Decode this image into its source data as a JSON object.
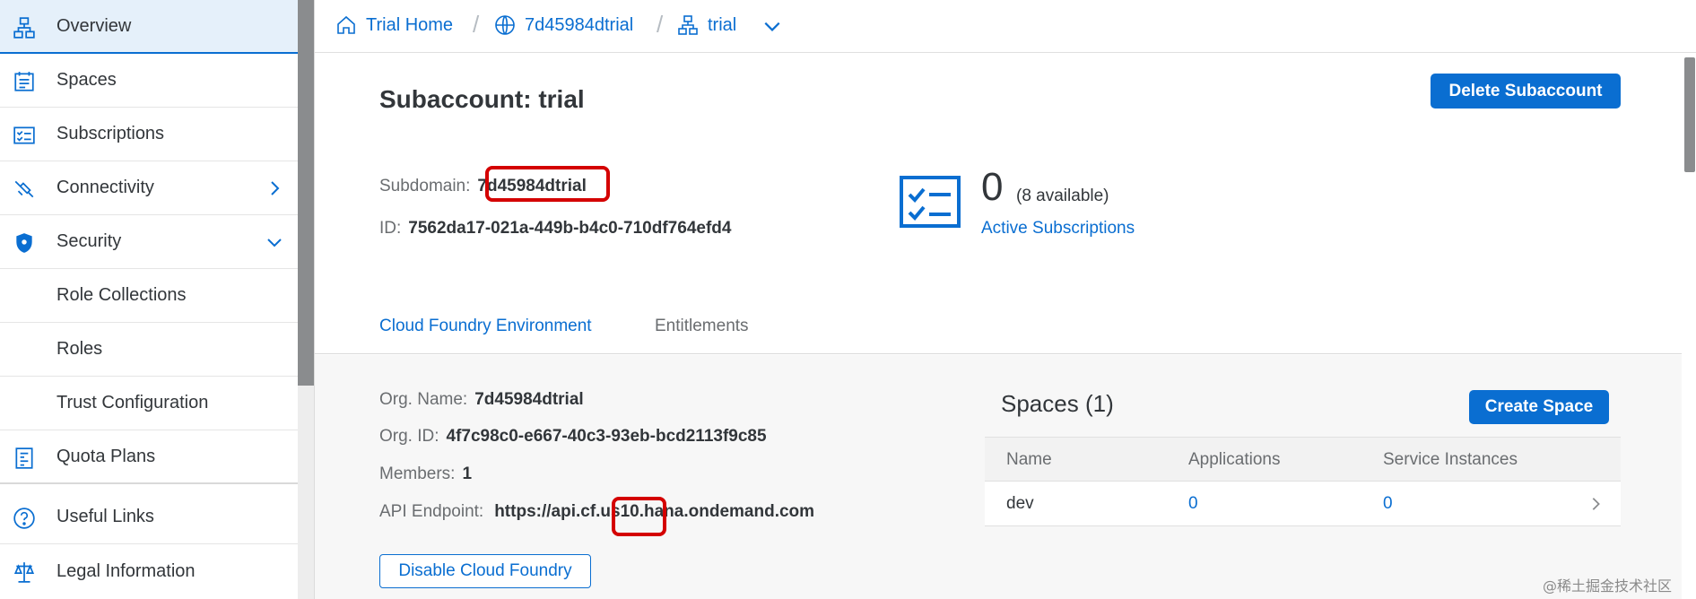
{
  "sidebar": {
    "items": [
      {
        "label": "Overview",
        "icon": "hierarchy-icon",
        "selected": true
      },
      {
        "label": "Spaces",
        "icon": "calendar-list-icon"
      },
      {
        "label": "Subscriptions",
        "icon": "checklist-icon"
      },
      {
        "label": "Connectivity",
        "icon": "connection-icon",
        "chevron": "chevron-right-icon"
      },
      {
        "label": "Security",
        "icon": "shield-icon",
        "chevron": "chevron-down-icon"
      },
      {
        "label": "Role Collections"
      },
      {
        "label": "Roles"
      },
      {
        "label": "Trust Configuration"
      },
      {
        "label": "Quota Plans",
        "icon": "quota-icon"
      },
      {
        "label": "Useful Links",
        "icon": "help-icon"
      },
      {
        "label": "Legal Information",
        "icon": "scale-icon"
      }
    ]
  },
  "breadcrumb": {
    "home": "Trial Home",
    "global_account": "7d45984dtrial",
    "subaccount": "trial"
  },
  "header": {
    "title": "Subaccount: trial",
    "delete_button": "Delete Subaccount"
  },
  "info": {
    "subdomain_label": "Subdomain:",
    "subdomain_value": "7d45984dtrial",
    "id_label": "ID:",
    "id_value": "7562da17-021a-449b-b4c0-710df764efd4"
  },
  "subscriptions": {
    "count": "0",
    "available": "(8 available)",
    "link": "Active Subscriptions"
  },
  "tabs": [
    {
      "label": "Cloud Foundry Environment",
      "active": true
    },
    {
      "label": "Entitlements",
      "active": false
    }
  ],
  "cf": {
    "org_name_label": "Org. Name:",
    "org_name_value": "7d45984dtrial",
    "org_id_label": "Org. ID:",
    "org_id_value": "4f7c98c0-e667-40c3-93eb-bcd2113f9c85",
    "members_label": "Members:",
    "members_value": "1",
    "api_label": "API Endpoint:",
    "api_value": "https://api.cf.us10.hana.ondemand.com",
    "disable_button": "Disable Cloud Foundry"
  },
  "spaces": {
    "title": "Spaces (1)",
    "create_button": "Create Space",
    "columns": [
      "Name",
      "Applications",
      "Service Instances"
    ],
    "rows": [
      {
        "name": "dev",
        "applications": "0",
        "service_instances": "0"
      }
    ]
  },
  "watermark": "@稀土掘金技术社区",
  "colors": {
    "accent": "#0a6ed1",
    "highlight": "#d40000",
    "selected_bg": "#e5f0fa"
  }
}
